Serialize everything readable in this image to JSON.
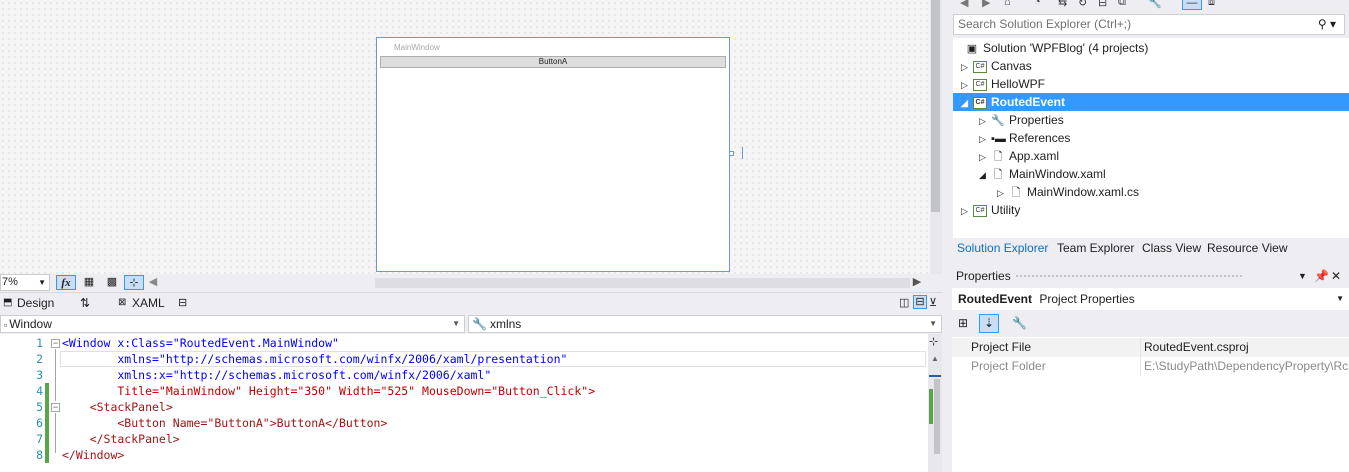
{
  "designer": {
    "window_title": "MainWindow",
    "button_text": "ButtonA"
  },
  "design_toolbar": {
    "zoom": "7%",
    "fx_label": "fx"
  },
  "split_tabs": {
    "design": "Design",
    "swap": "⇅",
    "xaml": "XAML"
  },
  "nav": {
    "element": "Window",
    "member": "xmlns"
  },
  "editor": {
    "lines": [
      {
        "n": "1",
        "text": "<Window x:Class=\"RoutedEvent.MainWindow\""
      },
      {
        "n": "2",
        "text": "        xmlns=\"http://schemas.microsoft.com/winfx/2006/xaml/presentation\""
      },
      {
        "n": "3",
        "text": "        xmlns:x=\"http://schemas.microsoft.com/winfx/2006/xaml\""
      },
      {
        "n": "4",
        "text": "        Title=\"MainWindow\" Height=\"350\" Width=\"525\" MouseDown=\"Button_Click\">"
      },
      {
        "n": "5",
        "text": "    <StackPanel>"
      },
      {
        "n": "6",
        "text": "        <Button Name=\"ButtonA\">ButtonA</Button>"
      },
      {
        "n": "7",
        "text": "    </StackPanel>"
      },
      {
        "n": "8",
        "text": "</Window>"
      }
    ]
  },
  "solution_explorer": {
    "search_placeholder": "Search Solution Explorer (Ctrl+;)",
    "tree": [
      {
        "label": "Solution 'WPFBlog' (4 projects)",
        "icon": "solution-icon"
      },
      {
        "label": "Canvas",
        "icon": "csharp-project-icon"
      },
      {
        "label": "HelloWPF",
        "icon": "csharp-project-icon"
      },
      {
        "label": "RoutedEvent",
        "icon": "csharp-project-icon",
        "selected": true
      },
      {
        "label": "Properties",
        "icon": "wrench-icon"
      },
      {
        "label": "References",
        "icon": "references-icon"
      },
      {
        "label": "App.xaml",
        "icon": "xaml-file-icon"
      },
      {
        "label": "MainWindow.xaml",
        "icon": "xaml-file-icon"
      },
      {
        "label": "MainWindow.xaml.cs",
        "icon": "cs-file-icon"
      },
      {
        "label": "Utility",
        "icon": "csharp-project-icon"
      }
    ],
    "tabs": [
      "Solution Explorer",
      "Team Explorer",
      "Class View",
      "Resource View"
    ]
  },
  "properties": {
    "title": "Properties",
    "object_name": "RoutedEvent",
    "object_type": "Project Properties",
    "rows": [
      {
        "name": "Project File",
        "value": "RoutedEvent.csproj"
      },
      {
        "name": "Project Folder",
        "value": "E:\\StudyPath\\DependencyProperty\\Rc"
      }
    ]
  },
  "colors": {
    "accent": "#3399ff",
    "selection_border": "#6e98d2",
    "change_marker": "#57a64a"
  }
}
